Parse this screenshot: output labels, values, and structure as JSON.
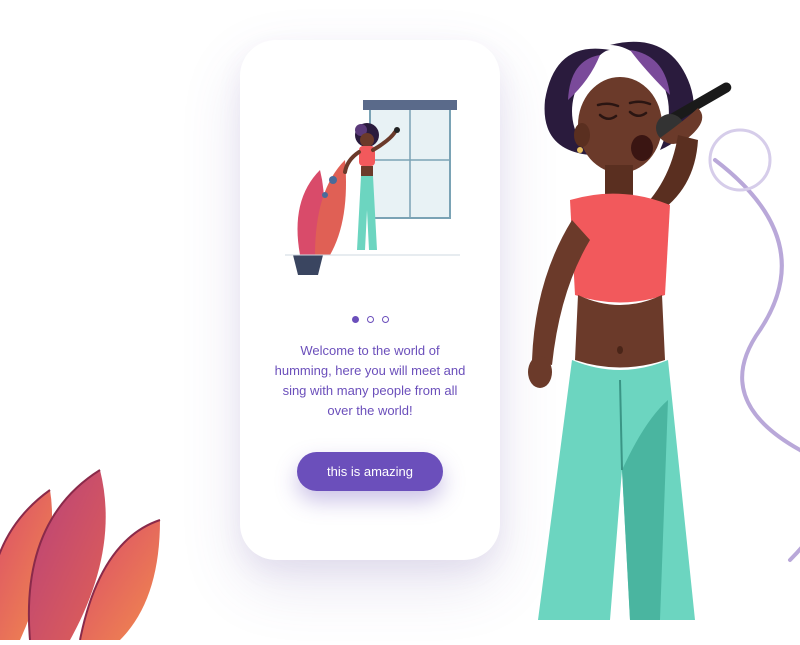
{
  "onboarding": {
    "welcome_text": "Welcome to the world of humming, here you will meet and sing with many people from all over the world!",
    "cta_label": "this is amazing",
    "page_count": 3,
    "active_page": 0
  },
  "colors": {
    "accent": "#6b4fbb",
    "coral": "#f2595c",
    "mint": "#6cd5c0",
    "skin": "#6b3a2a",
    "hair": "#2a1b3d"
  }
}
